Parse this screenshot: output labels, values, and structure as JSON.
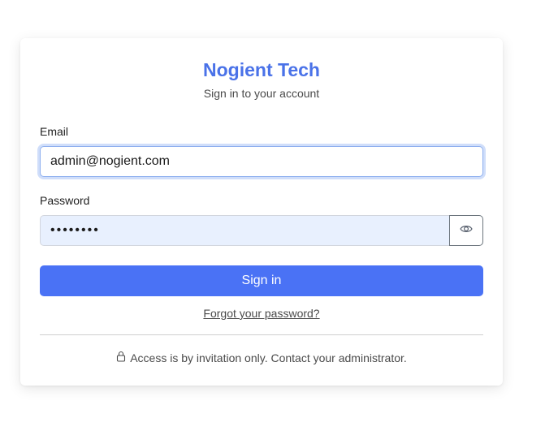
{
  "brand": {
    "name": "Nogient Tech",
    "subtitle": "Sign in to your account"
  },
  "form": {
    "email_label": "Email",
    "email_value": "admin@nogient.com",
    "password_label": "Password",
    "password_value": "••••••••",
    "toggle_icon": "eye-icon",
    "submit_label": "Sign in",
    "forgot_link": "Forgot your password?"
  },
  "footer": {
    "icon": "lock-icon",
    "notice": "Access is by invitation only. Contact your administrator."
  },
  "colors": {
    "brand": "#4a72e8",
    "button": "#4a72f5",
    "password_bg": "#e8f0fe"
  }
}
